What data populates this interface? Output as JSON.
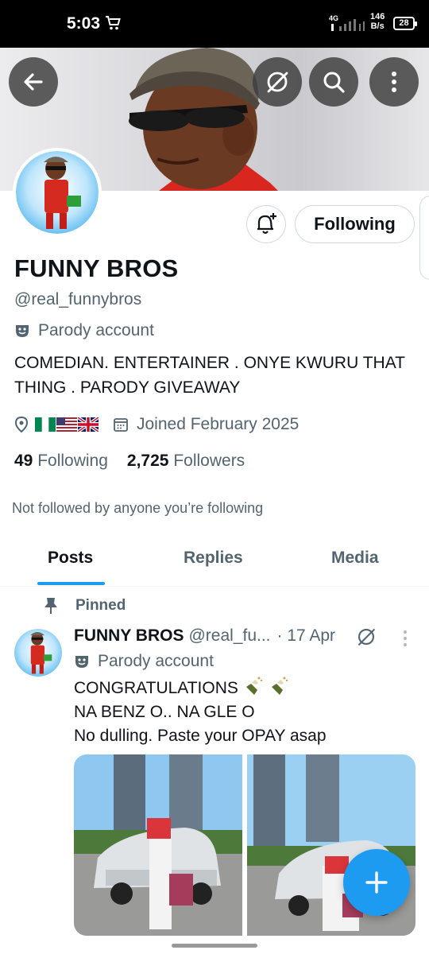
{
  "status_bar": {
    "time": "5:03",
    "network_label": "4G",
    "speed_value": "146",
    "speed_unit": "B/s",
    "battery": "28"
  },
  "icons": {
    "back": "arrow-left-icon",
    "grok": "grok-icon",
    "search": "search-icon",
    "more": "more-vertical-icon",
    "notify": "bell-plus-icon",
    "parody": "theater-mask-icon",
    "location": "location-pin-icon",
    "calendar": "calendar-icon",
    "pin": "pin-icon",
    "compose": "plus-icon"
  },
  "profile": {
    "display_name": "FUNNY BROS",
    "handle": "@real_funnybros",
    "parody_label": "Parody account",
    "bio": "COMEDIAN. ENTERTAINER . ONYE KWURU THAT THING . PARODY GIVEAWAY",
    "location_flags": [
      "Nigeria",
      "United States",
      "United Kingdom"
    ],
    "joined": "Joined February 2025",
    "following_count": "49",
    "following_label": "Following",
    "followers_count": "2,725",
    "followers_label": "Followers",
    "not_followed_text": "Not followed by anyone you’re following",
    "follow_button": "Following"
  },
  "tabs": [
    {
      "label": "Posts",
      "active": true
    },
    {
      "label": "Replies",
      "active": false
    },
    {
      "label": "Media",
      "active": false
    }
  ],
  "pinned_post": {
    "pinned_label": "Pinned",
    "author_name": "FUNNY BROS",
    "author_handle": "@real_fu...",
    "date": "· 17 Apr",
    "parody_label": "Parody account",
    "lines": [
      "CONGRATULATIONS",
      "NA BENZ O.. NA GLE O",
      "No dulling. Paste your OPAY asap"
    ],
    "line1_emoji": "bottle-with-popping-cork"
  },
  "colors": {
    "accent": "#1d9bf0",
    "text_primary": "#0f1419",
    "text_secondary": "#536471",
    "border": "#cfd9de"
  }
}
